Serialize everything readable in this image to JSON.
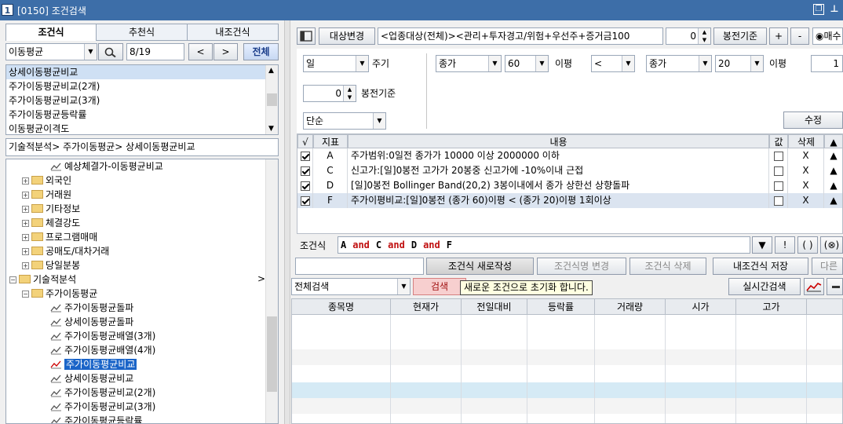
{
  "window": {
    "number": "1",
    "title": "[0150] 조건검색"
  },
  "left": {
    "tabs": [
      "조건식",
      "추천식",
      "내조건식"
    ],
    "search": {
      "value": "이동평균",
      "date": "8/19",
      "prev": "<",
      "next": ">",
      "all_label": "전체"
    },
    "results": [
      "상세이동평균비교",
      "주가이동평균비교(2개)",
      "주가이동평균비교(3개)",
      "주가이동평균등락률",
      "이동평균이격도"
    ],
    "breadcrumb": "기술적분석> 주가이동평균> 상세이동평균비교",
    "tree": [
      {
        "label": "예상체결가-이동평균비교",
        "type": "chart"
      },
      {
        "label": "외국인",
        "type": "folder"
      },
      {
        "label": "거래원",
        "type": "folder"
      },
      {
        "label": "기타정보",
        "type": "folder"
      },
      {
        "label": "체결강도",
        "type": "folder"
      },
      {
        "label": "프로그램매매",
        "type": "folder"
      },
      {
        "label": "공매도/대차거래",
        "type": "folder"
      },
      {
        "label": "당일분봉",
        "type": "folder"
      },
      {
        "label": "기술적분석",
        "type": "folder-open"
      },
      {
        "label": "주가이동평균",
        "type": "folder-open"
      },
      {
        "label": "주가이동평균돌파",
        "type": "chart"
      },
      {
        "label": "상세이동평균돌파",
        "type": "chart"
      },
      {
        "label": "주가이동평균배열(3개)",
        "type": "chart"
      },
      {
        "label": "주가이동평균배열(4개)",
        "type": "chart"
      },
      {
        "label": "주가이동평균비교",
        "type": "chart"
      },
      {
        "label": "상세이동평균비교",
        "type": "chart"
      },
      {
        "label": "주가이동평균비교(2개)",
        "type": "chart"
      },
      {
        "label": "주가이동평균비교(3개)",
        "type": "chart"
      },
      {
        "label": "주가이동평균등락률",
        "type": "chart"
      }
    ],
    "tree_arrow": ">"
  },
  "right": {
    "target_btn": "대상변경",
    "target_text": "<업종대상(전체)><관리+투자경고/위험+우선주+증거금100",
    "bong_value": "0",
    "bong_label": "봉전기준",
    "plus": "+",
    "minus": "-",
    "radio_label": "◉매수",
    "period_select": "일",
    "period_label": "주기",
    "price_select1": "종가",
    "ma_select1": "60",
    "ipyeong1": "이평",
    "op_select": "<",
    "price_select2": "종가",
    "ma_select2": "20",
    "ipyeong2": "이평",
    "count_value": "1",
    "bong_value2": "0",
    "bong_label2": "봉전기준",
    "mode_select": "단순",
    "modify_btn": "수정",
    "grid_headers": [
      "√",
      "지표",
      "내용",
      "값",
      "삭제",
      "▲"
    ],
    "conditions": [
      {
        "id": "A",
        "text": "주가범위:0일전 종가가 10000 이상 2000000 이하",
        "del": "X",
        "up": "▲"
      },
      {
        "id": "C",
        "text": "신고가:[일]0봉전 고가가 20봉중 신고가에 -10%이내 근접",
        "del": "X",
        "up": "▲"
      },
      {
        "id": "D",
        "text": "[일]0봉전 Bollinger Band(20,2) 3봉이내에서 종가 상한선 상향돌파",
        "del": "X",
        "up": "▲"
      },
      {
        "id": "F",
        "text": "주가이평비교:[일]0봉전 (종가 60)이평 < (종가 20)이평 1회이상",
        "del": "X",
        "up": "▲"
      }
    ],
    "formula_label": "조건식",
    "formula": [
      "A",
      "and",
      "C",
      "and",
      "D",
      "and",
      "F"
    ],
    "formula_btns": [
      "▼",
      "!",
      "( )",
      "(⊗)"
    ],
    "actions": [
      "조건식 새로작성",
      "조건식명 변경",
      "조건식 삭제",
      "내조건식 저장",
      "다른"
    ],
    "scope_select": "전체검색",
    "search_btn": "검색",
    "tooltip": "새로운 조건으로 초기화 합니다.",
    "realtime_btn": "실시간검색",
    "result_headers": [
      "종목명",
      "현재가",
      "전일대비",
      "등락률",
      "거래량",
      "시가",
      "고가"
    ]
  }
}
